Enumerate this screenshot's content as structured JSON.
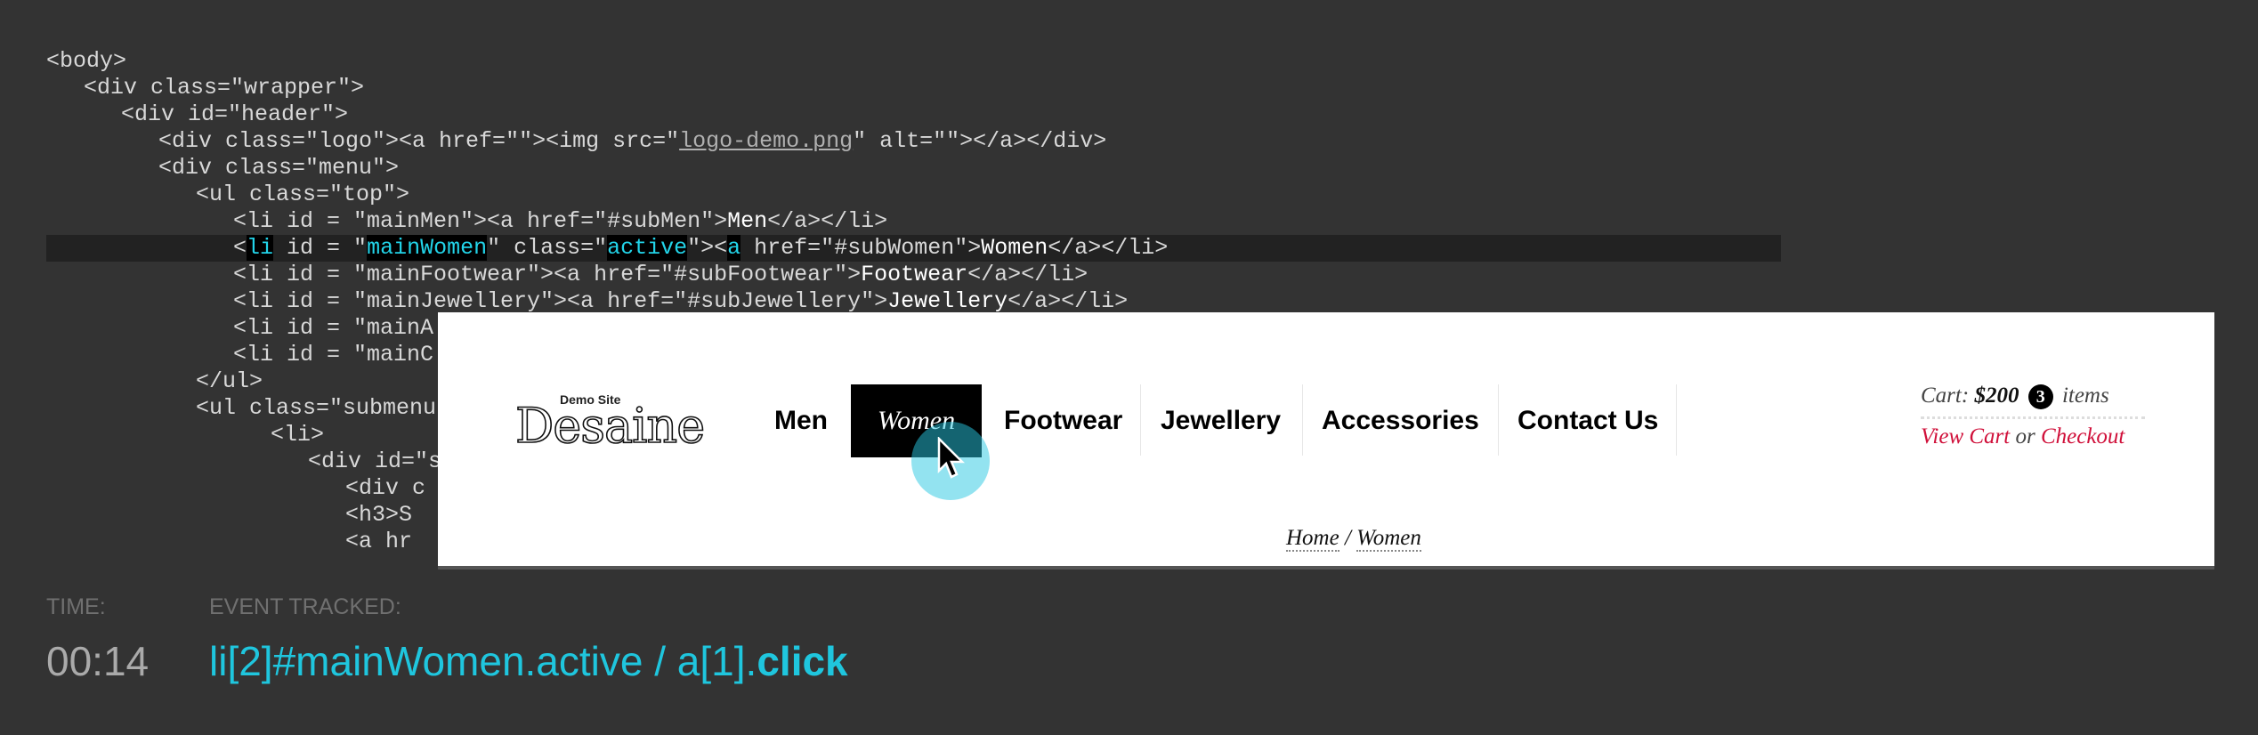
{
  "code_lines": [
    {
      "indent": 0,
      "text": "<body>"
    },
    {
      "indent": 1,
      "text": "<div class=\"wrapper\">"
    },
    {
      "indent": 2,
      "text": "<div id=\"header\">"
    },
    {
      "indent": 3,
      "pre": "<div class=\"logo\"><a href=\"\"><img src=\"",
      "link": "logo-demo.png",
      "post": "\" alt=\"\"></a></div>"
    },
    {
      "indent": 3,
      "text": "<div class=\"menu\">"
    },
    {
      "indent": 4,
      "text": "<ul class=\"top\">"
    },
    {
      "indent": 5,
      "pre": "<li id = \"mainMen\"><a href=\"#subMen\">",
      "content": "Men",
      "post": "</a></li>"
    },
    {
      "indent": 5,
      "highlight": true
    },
    {
      "indent": 5,
      "pre": "<li id = \"mainFootwear\"><a href=\"#subFootwear\">",
      "content": "Footwear",
      "post": "</a></li>"
    },
    {
      "indent": 5,
      "pre": "<li id = \"mainJewellery\"><a href=\"#subJewellery\">",
      "content": "Jewellery",
      "post": "</a></li>"
    },
    {
      "indent": 5,
      "text": "<li id = \"mainA"
    },
    {
      "indent": 5,
      "text": "<li id = \"mainC"
    },
    {
      "indent": 4,
      "text": "</ul>"
    },
    {
      "indent": 4,
      "text": "<ul class=\"submenu"
    },
    {
      "indent": 6,
      "text": "<li>"
    },
    {
      "indent": 7,
      "text": "<div id=\"s"
    },
    {
      "indent": 8,
      "text": "<div c"
    },
    {
      "indent": 8,
      "text": "<h3>S"
    },
    {
      "indent": 8,
      "text": "<a hr"
    }
  ],
  "highlight_line": {
    "p1": "<",
    "t1": "li",
    "p2": " id = \"",
    "t2": "mainWomen",
    "p3": "\" class=\"",
    "t3": "active",
    "p4": "\"><",
    "t4": "a",
    "p5": " href=\"#subWomen\">",
    "content": "Women",
    "p6": "</a></li>"
  },
  "site": {
    "logo_small": "Demo Site",
    "logo_big": "Desaine",
    "nav": [
      {
        "label": "Men",
        "active": false
      },
      {
        "label": "Women",
        "active": true
      },
      {
        "label": "Footwear",
        "active": false
      },
      {
        "label": "Jewellery",
        "active": false
      },
      {
        "label": "Accessories",
        "active": false
      },
      {
        "label": "Contact Us",
        "active": false
      }
    ],
    "cart": {
      "label": "Cart:",
      "amount": "$200",
      "count": "3",
      "items": "items",
      "view_cart": "View Cart",
      "or": "or",
      "checkout": "Checkout"
    },
    "breadcrumb": {
      "home": "Home",
      "sep": "/",
      "current": "Women"
    }
  },
  "tracker": {
    "time_label": "TIME:",
    "event_label": "EVENT TRACKED:",
    "time": "00:14",
    "event_path": "li[2]#mainWomen.active / a[1].",
    "event_action": "click"
  },
  "colors": {
    "accent": "#1fc6de",
    "link_red": "#d0103a",
    "background": "#333333"
  }
}
